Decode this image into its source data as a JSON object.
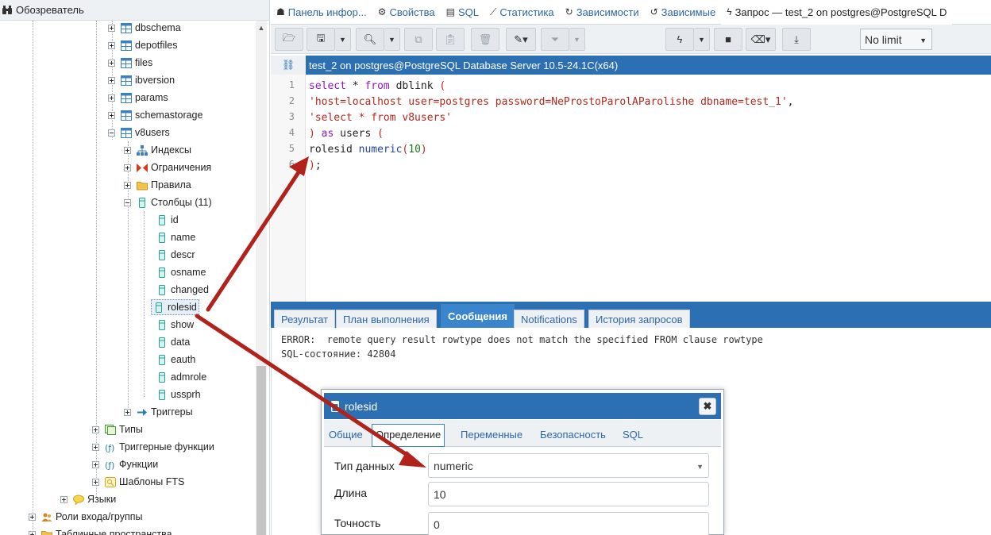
{
  "browser": {
    "title": "Обозреватель",
    "nodes": [
      {
        "label": "dbschema"
      },
      {
        "label": "depotfiles"
      },
      {
        "label": "files"
      },
      {
        "label": "ibversion"
      },
      {
        "label": "params"
      },
      {
        "label": "schemastorage"
      },
      {
        "label": "v8users"
      },
      {
        "label": "Индексы"
      },
      {
        "label": "Ограничения"
      },
      {
        "label": "Правила"
      },
      {
        "label": "Столбцы (11)"
      },
      {
        "label": "id"
      },
      {
        "label": "name"
      },
      {
        "label": "descr"
      },
      {
        "label": "osname"
      },
      {
        "label": "changed"
      },
      {
        "label": "rolesid"
      },
      {
        "label": "show"
      },
      {
        "label": "data"
      },
      {
        "label": "eauth"
      },
      {
        "label": "admrole"
      },
      {
        "label": "ussprh"
      },
      {
        "label": "Триггеры"
      },
      {
        "label": "Типы"
      },
      {
        "label": "Триггерные функции"
      },
      {
        "label": "Функции"
      },
      {
        "label": "Шаблоны FTS"
      },
      {
        "label": "Языки"
      },
      {
        "label": "Роли входа/группы"
      },
      {
        "label": "Табличные пространства"
      }
    ]
  },
  "tabs": [
    {
      "label": "Панель инфор...",
      "icon": "dashboard-icon"
    },
    {
      "label": "Свойства",
      "icon": "properties-icon"
    },
    {
      "label": "SQL",
      "icon": "sql-file-icon"
    },
    {
      "label": "Статистика",
      "icon": "chart-icon"
    },
    {
      "label": "Зависимости",
      "icon": "dependencies-icon"
    },
    {
      "label": "Зависимые",
      "icon": "dependents-icon"
    },
    {
      "label": "Запрос — test_2 on postgres@PostgreSQL D",
      "icon": "lightning-icon"
    }
  ],
  "toolbar": {
    "limit": "No limit"
  },
  "editor": {
    "title": "test_2 on postgres@PostgreSQL Database Server 10.5-24.1C(x64)",
    "line_numbers": [
      "1",
      "2",
      "3",
      "4",
      "5",
      "6"
    ],
    "lines": [
      [
        {
          "t": "select",
          "c": "kw"
        },
        {
          "t": " * ",
          "c": "pl"
        },
        {
          "t": "from",
          "c": "kw"
        },
        {
          "t": " dblink ",
          "c": "pl"
        },
        {
          "t": "(",
          "c": "str"
        }
      ],
      [
        {
          "t": "'host=localhost user=postgres password=NeProstoParolAParolishe dbname=test_1'",
          "c": "str"
        },
        {
          "t": ",",
          "c": "pl"
        }
      ],
      [
        {
          "t": "'select * from v8users'",
          "c": "str"
        }
      ],
      [
        {
          "t": ")",
          "c": "str"
        },
        {
          "t": " ",
          "c": "pl"
        },
        {
          "t": "as",
          "c": "kw"
        },
        {
          "t": " users ",
          "c": "pl"
        },
        {
          "t": "(",
          "c": "str"
        }
      ],
      [
        {
          "t": "rolesid ",
          "c": "pl"
        },
        {
          "t": "numeric",
          "c": "fn"
        },
        {
          "t": "(",
          "c": "str"
        },
        {
          "t": "10",
          "c": "num"
        },
        {
          "t": ")",
          "c": "str"
        }
      ],
      [
        {
          "t": ")",
          "c": "str"
        },
        {
          "t": ";",
          "c": "pl"
        }
      ]
    ]
  },
  "results": {
    "tabs": [
      "Результат",
      "План выполнения",
      "Сообщения",
      "Notifications",
      "История запросов"
    ],
    "active_tab": "Сообщения",
    "messages": [
      "ERROR:  remote query result rowtype does not match the specified FROM clause rowtype",
      "SQL-состояние: 42804"
    ]
  },
  "dialog": {
    "title": "rolesid",
    "close": "✖",
    "tabs": [
      "Общие",
      "Определение",
      "Переменные",
      "Безопасность",
      "SQL"
    ],
    "active_tab": "Определение",
    "fields": [
      {
        "label": "Тип данных",
        "value": "numeric"
      },
      {
        "label": "Длина",
        "value": "10"
      },
      {
        "label": "Точность",
        "value": "0"
      }
    ]
  },
  "colors": {
    "accent": "#2c6fb3",
    "arrow": "#b0221a"
  }
}
